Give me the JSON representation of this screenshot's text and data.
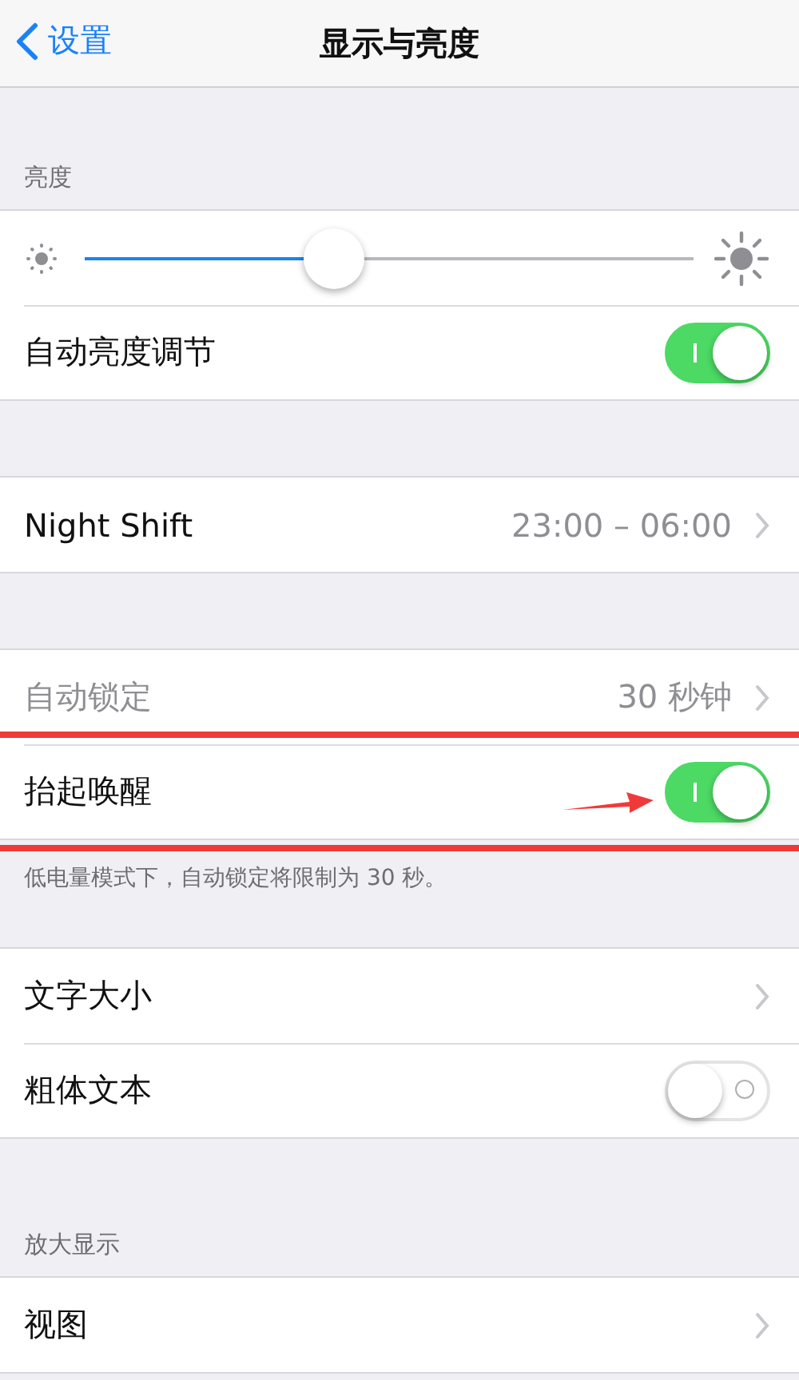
{
  "nav": {
    "back": "设置",
    "title": "显示与亮度"
  },
  "sections": [
    {
      "header": "亮度",
      "rows": [
        {
          "kind": "slider",
          "level": 0.41,
          "highlighted": false
        },
        {
          "kind": "toggle",
          "label": "自动亮度调节",
          "on": true,
          "highlighted": false
        }
      ]
    },
    {
      "rows": [
        {
          "kind": "link",
          "label": "Night Shift",
          "value": "23:00 – 06:00",
          "disabled": false,
          "highlighted": false
        }
      ]
    },
    {
      "rows": [
        {
          "kind": "link",
          "label": "自动锁定",
          "value": "30 秒钟",
          "disabled": true,
          "highlighted": false
        },
        {
          "kind": "toggle",
          "label": "抬起唤醒",
          "on": true,
          "highlighted": true
        }
      ],
      "footer": "低电量模式下，自动锁定将限制为 30 秒。"
    },
    {
      "rows": [
        {
          "kind": "link",
          "label": "文字大小",
          "disabled": false,
          "highlighted": false
        },
        {
          "kind": "toggle",
          "label": "粗体文本",
          "on": false,
          "highlighted": false
        }
      ]
    },
    {
      "header": "放大显示",
      "rows": [
        {
          "kind": "link",
          "label": "视图",
          "disabled": false,
          "highlighted": false
        }
      ]
    }
  ]
}
